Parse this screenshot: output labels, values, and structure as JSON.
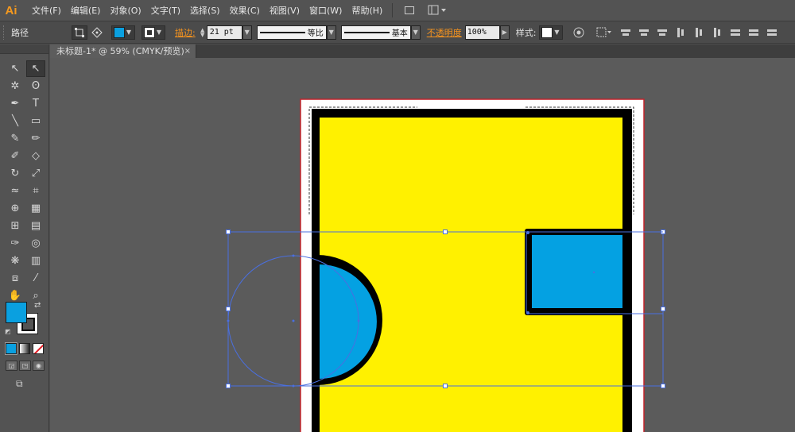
{
  "app": {
    "logo": "Ai"
  },
  "menu": {
    "items": [
      "文件(F)",
      "编辑(E)",
      "对象(O)",
      "文字(T)",
      "选择(S)",
      "效果(C)",
      "视图(V)",
      "窗口(W)",
      "帮助(H)"
    ],
    "icons": [
      "bridge-icon",
      "arrange-documents-icon"
    ]
  },
  "control": {
    "selection_type": "路径",
    "fill_color": "#0aa0e0",
    "stroke_label": "描边:",
    "stroke_weight": "21 pt",
    "profile_label": "等比",
    "brush_label": "基本",
    "opacity_label": "不透明度",
    "opacity_value": "100%",
    "style_label": "样式:"
  },
  "document": {
    "tab_title": "未标题-1* @ 59% (CMYK/预览)",
    "close_glyph": "×"
  },
  "colors": {
    "fill": "#0aa0e0",
    "artwork_yellow": "#fff100",
    "artwork_blue": "#04a1e2",
    "selection": "#4a6fe0",
    "artboard_border": "#c4232b"
  },
  "tools": [
    {
      "name": "selection-tool",
      "glyph": "↖"
    },
    {
      "name": "direct-selection-tool",
      "glyph": "↖",
      "active": true
    },
    {
      "name": "magic-wand-tool",
      "glyph": "✲"
    },
    {
      "name": "lasso-tool",
      "glyph": "ʘ"
    },
    {
      "name": "pen-tool",
      "glyph": "✒"
    },
    {
      "name": "type-tool",
      "glyph": "T"
    },
    {
      "name": "line-segment-tool",
      "glyph": "╲"
    },
    {
      "name": "rectangle-tool",
      "glyph": "▭"
    },
    {
      "name": "paintbrush-tool",
      "glyph": "✎"
    },
    {
      "name": "pencil-tool",
      "glyph": "✏"
    },
    {
      "name": "blob-brush-tool",
      "glyph": "✐"
    },
    {
      "name": "eraser-tool",
      "glyph": "◇"
    },
    {
      "name": "rotate-tool",
      "glyph": "↻"
    },
    {
      "name": "scale-tool",
      "glyph": "⤢"
    },
    {
      "name": "warp-tool",
      "glyph": "≈"
    },
    {
      "name": "free-transform-tool",
      "glyph": "⌗"
    },
    {
      "name": "shape-builder-tool",
      "glyph": "⊕"
    },
    {
      "name": "perspective-grid-tool",
      "glyph": "▦"
    },
    {
      "name": "mesh-tool",
      "glyph": "⊞"
    },
    {
      "name": "gradient-tool",
      "glyph": "▤"
    },
    {
      "name": "eyedropper-tool",
      "glyph": "✑"
    },
    {
      "name": "blend-tool",
      "glyph": "◎"
    },
    {
      "name": "symbol-sprayer-tool",
      "glyph": "❋"
    },
    {
      "name": "column-graph-tool",
      "glyph": "▥"
    },
    {
      "name": "artboard-tool",
      "glyph": "⧈"
    },
    {
      "name": "slice-tool",
      "glyph": "⁄"
    },
    {
      "name": "hand-tool",
      "glyph": "✋"
    },
    {
      "name": "zoom-tool",
      "glyph": "⌕"
    }
  ]
}
